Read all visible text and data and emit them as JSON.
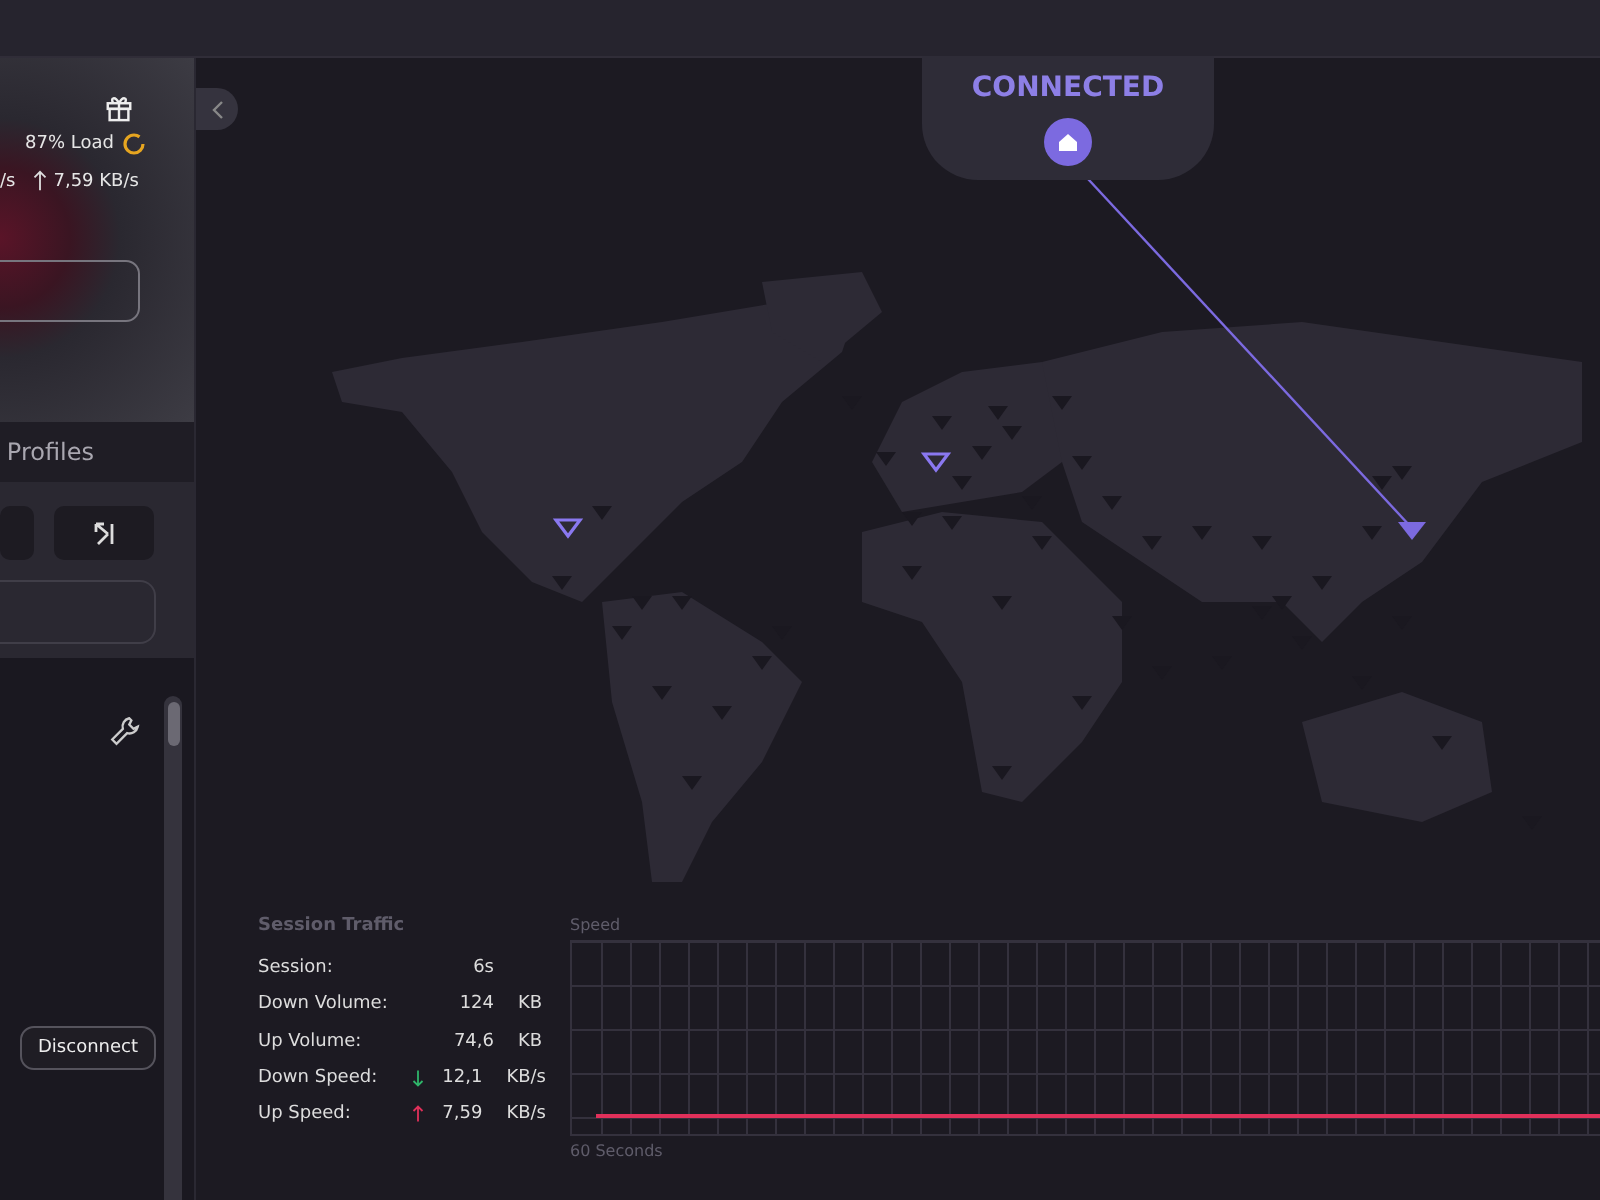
{
  "sidebar": {
    "load": "87% Load",
    "down_speed": "/s",
    "up_speed": "7,59 KB/s",
    "tab": "Profiles",
    "disconnect_button": "Disconnect"
  },
  "map": {
    "status": "CONNECTED"
  },
  "session_traffic": {
    "title": "Session Traffic",
    "rows": [
      {
        "label": "Session:",
        "value": "6s",
        "unit": "",
        "kind": "plain"
      },
      {
        "label": "Down Volume:",
        "value": "124",
        "unit": "KB",
        "kind": "plain"
      },
      {
        "label": "Up Volume:",
        "value": "74,6",
        "unit": "KB",
        "kind": "plain"
      },
      {
        "label": "Down Speed:",
        "value": "12,1",
        "unit": "KB/s",
        "kind": "down"
      },
      {
        "label": "Up Speed:",
        "value": "7,59",
        "unit": "KB/s",
        "kind": "up"
      }
    ]
  },
  "speed_graph": {
    "title": "Speed",
    "caption": "60 Seconds"
  }
}
